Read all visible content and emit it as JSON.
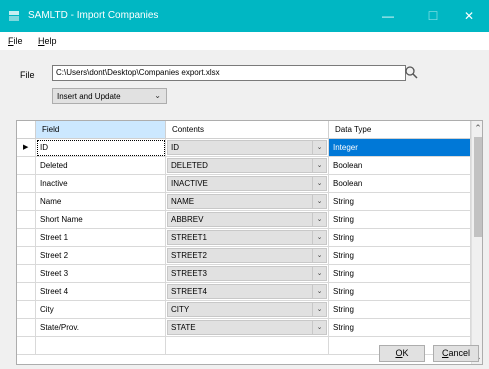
{
  "window": {
    "title": "SAMLTD - Import Companies",
    "minimize": "—",
    "maximize": "☐",
    "close": "✕"
  },
  "menu": [
    {
      "mnemonic": "F",
      "rest": "ile"
    },
    {
      "mnemonic": "H",
      "rest": "elp"
    }
  ],
  "file": {
    "label": "File",
    "path": "C:\\Users\\dont\\Desktop\\Companies export.xlsx"
  },
  "mode": {
    "selected": "Insert and Update"
  },
  "grid": {
    "columns": [
      "Field",
      "Contents",
      "Data Type"
    ],
    "rows": [
      {
        "field": "ID",
        "contents": "ID",
        "type": "Integer"
      },
      {
        "field": "Deleted",
        "contents": "DELETED",
        "type": "Boolean"
      },
      {
        "field": "Inactive",
        "contents": "INACTIVE",
        "type": "Boolean"
      },
      {
        "field": "Name",
        "contents": "NAME",
        "type": "String"
      },
      {
        "field": "Short Name",
        "contents": "ABBREV",
        "type": "String"
      },
      {
        "field": "Street 1",
        "contents": "STREET1",
        "type": "String"
      },
      {
        "field": "Street 2",
        "contents": "STREET2",
        "type": "String"
      },
      {
        "field": "Street 3",
        "contents": "STREET3",
        "type": "String"
      },
      {
        "field": "Street 4",
        "contents": "STREET4",
        "type": "String"
      },
      {
        "field": "City",
        "contents": "CITY",
        "type": "String"
      },
      {
        "field": "State/Prov.",
        "contents": "STATE",
        "type": "String"
      },
      {
        "field": "",
        "contents": "",
        "type": ""
      }
    ]
  },
  "buttons": {
    "ok": {
      "mnemonic": "O",
      "rest": "K"
    },
    "cancel": {
      "mnemonic": "C",
      "rest": "ancel"
    }
  },
  "colors": {
    "titlebar": "#00b7c3",
    "selection": "#0078d7",
    "header_selected": "#cce8ff"
  }
}
